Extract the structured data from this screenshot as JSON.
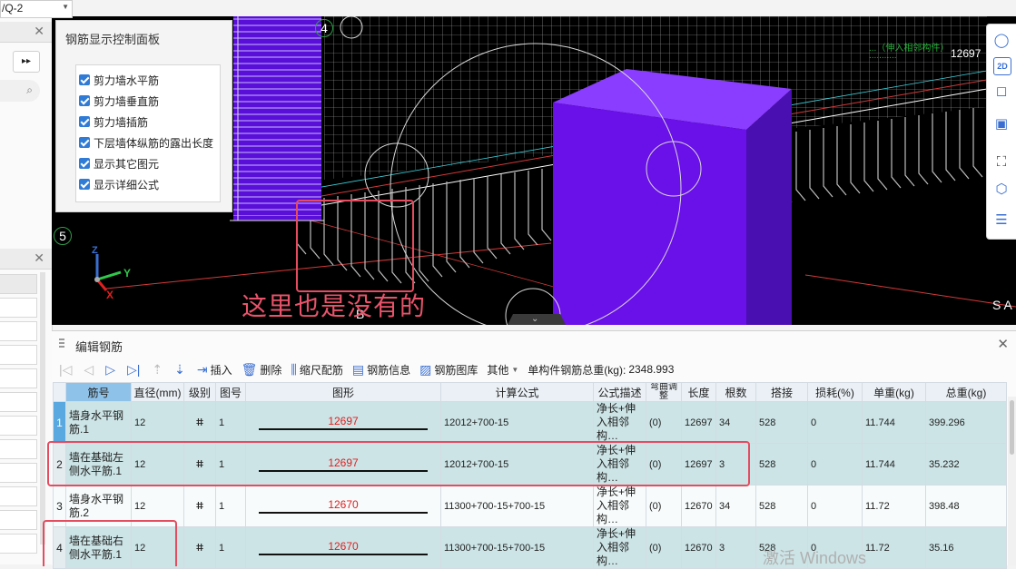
{
  "top_dropdown": {
    "value": "/Q-2"
  },
  "control_panel": {
    "title": "钢筋显示控制面板",
    "items": [
      {
        "label": "剪力墙水平筋",
        "checked": true
      },
      {
        "label": "剪力墙垂直筋",
        "checked": true
      },
      {
        "label": "剪力墙插筋",
        "checked": true
      },
      {
        "label": "下层墙体纵筋的露出长度",
        "checked": true
      },
      {
        "label": "显示其它图元",
        "checked": true
      },
      {
        "label": "显示详细公式",
        "checked": true
      }
    ]
  },
  "viewport": {
    "axis_labels": {
      "4": "4",
      "5": "5",
      "B": "B",
      "SA": "S A"
    },
    "dimension_text": "12697",
    "axis_letters": {
      "z": "Z",
      "y": "Y",
      "x": "X"
    },
    "green_text_1": "...（伸入相邻构件）",
    "green_text_2": "...........",
    "annotation": "这里也是没有的"
  },
  "edit_panel": {
    "title": "编辑钢筋",
    "toolbar": {
      "insert": "插入",
      "delete": "删除",
      "scale_rebar": "缩尺配筋",
      "rebar_info": "钢筋信息",
      "rebar_library": "钢筋图库",
      "other": "其他",
      "total_weight_label": "单构件钢筋总重(kg):",
      "total_weight_value": "2348.993"
    },
    "columns": [
      "筋号",
      "直径(mm)",
      "级别",
      "图号",
      "图形",
      "计算公式",
      "公式描述",
      "弯曲调整",
      "长度",
      "根数",
      "搭接",
      "损耗(%)",
      "单重(kg)",
      "总重(kg)"
    ],
    "rows": [
      {
        "n": "1",
        "name": "墙身水平钢筋.1",
        "dia": "12",
        "grade": "ⵌ",
        "fig": "1",
        "shape": "12697",
        "formula": "12012+700-15",
        "desc": "净长+伸入相邻构…",
        "bend": "(0)",
        "len": "12697",
        "count": "34",
        "lap": "528",
        "loss": "0",
        "unit": "11.744",
        "total": "399.296"
      },
      {
        "n": "2",
        "name": "墙在基础左侧水平筋.1",
        "dia": "12",
        "grade": "ⵌ",
        "fig": "1",
        "shape": "12697",
        "formula": "12012+700-15",
        "desc": "净长+伸入相邻构…",
        "bend": "(0)",
        "len": "12697",
        "count": "3",
        "lap": "528",
        "loss": "0",
        "unit": "11.744",
        "total": "35.232"
      },
      {
        "n": "3",
        "name": "墙身水平钢筋.2",
        "dia": "12",
        "grade": "ⵌ",
        "fig": "1",
        "shape": "12670",
        "formula": "11300+700-15+700-15",
        "desc": "净长+伸入相邻构…",
        "bend": "(0)",
        "len": "12670",
        "count": "34",
        "lap": "528",
        "loss": "0",
        "unit": "11.72",
        "total": "398.48"
      },
      {
        "n": "4",
        "name": "墙在基础右侧水平筋.1",
        "dia": "12",
        "grade": "ⵌ",
        "fig": "1",
        "shape": "12670",
        "formula": "11300+700-15+700-15",
        "desc": "净长+伸入相邻构…",
        "bend": "(0)",
        "len": "12670",
        "count": "3",
        "lap": "528",
        "loss": "0",
        "unit": "11.72",
        "total": "35.16"
      }
    ]
  },
  "watermark": "激活 Windows",
  "colors": {
    "accent": "#3a6fd1",
    "highlight": "#e44c60",
    "wall": "#6a10e8",
    "row_bg": "#cce4e6"
  }
}
